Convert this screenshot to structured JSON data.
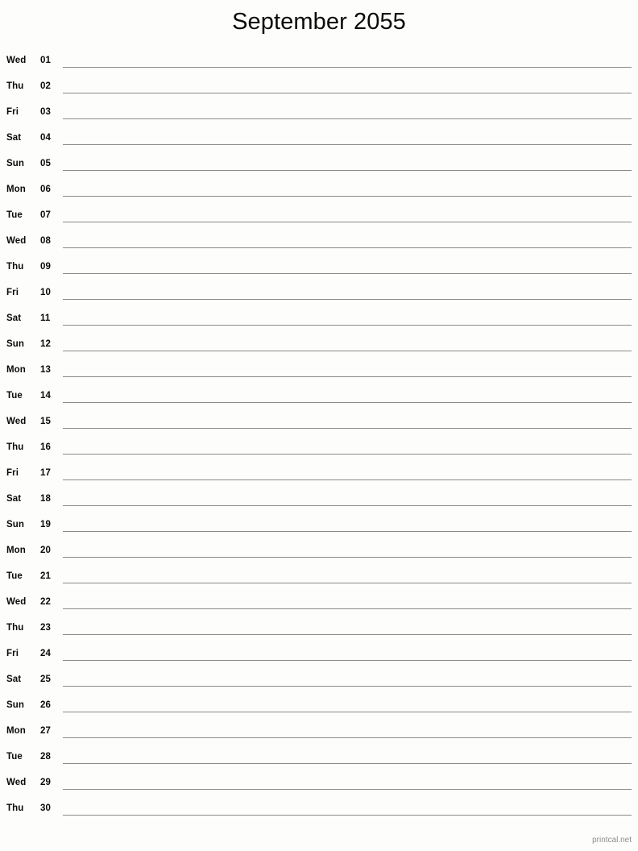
{
  "document": {
    "title": "September 2055",
    "type": "printable-monthly-calendar",
    "layout": "single-column-notes-list"
  },
  "colors": {
    "background": "#fdfdfb",
    "text": "#0a0a0a",
    "rule": "#8a8a86",
    "footer_text": "#8d8d8d"
  },
  "days": [
    {
      "dow": "Wed",
      "num": "01"
    },
    {
      "dow": "Thu",
      "num": "02"
    },
    {
      "dow": "Fri",
      "num": "03"
    },
    {
      "dow": "Sat",
      "num": "04"
    },
    {
      "dow": "Sun",
      "num": "05"
    },
    {
      "dow": "Mon",
      "num": "06"
    },
    {
      "dow": "Tue",
      "num": "07"
    },
    {
      "dow": "Wed",
      "num": "08"
    },
    {
      "dow": "Thu",
      "num": "09"
    },
    {
      "dow": "Fri",
      "num": "10"
    },
    {
      "dow": "Sat",
      "num": "11"
    },
    {
      "dow": "Sun",
      "num": "12"
    },
    {
      "dow": "Mon",
      "num": "13"
    },
    {
      "dow": "Tue",
      "num": "14"
    },
    {
      "dow": "Wed",
      "num": "15"
    },
    {
      "dow": "Thu",
      "num": "16"
    },
    {
      "dow": "Fri",
      "num": "17"
    },
    {
      "dow": "Sat",
      "num": "18"
    },
    {
      "dow": "Sun",
      "num": "19"
    },
    {
      "dow": "Mon",
      "num": "20"
    },
    {
      "dow": "Tue",
      "num": "21"
    },
    {
      "dow": "Wed",
      "num": "22"
    },
    {
      "dow": "Thu",
      "num": "23"
    },
    {
      "dow": "Fri",
      "num": "24"
    },
    {
      "dow": "Sat",
      "num": "25"
    },
    {
      "dow": "Sun",
      "num": "26"
    },
    {
      "dow": "Mon",
      "num": "27"
    },
    {
      "dow": "Tue",
      "num": "28"
    },
    {
      "dow": "Wed",
      "num": "29"
    },
    {
      "dow": "Thu",
      "num": "30"
    }
  ],
  "footer": {
    "attribution": "printcal.net"
  }
}
